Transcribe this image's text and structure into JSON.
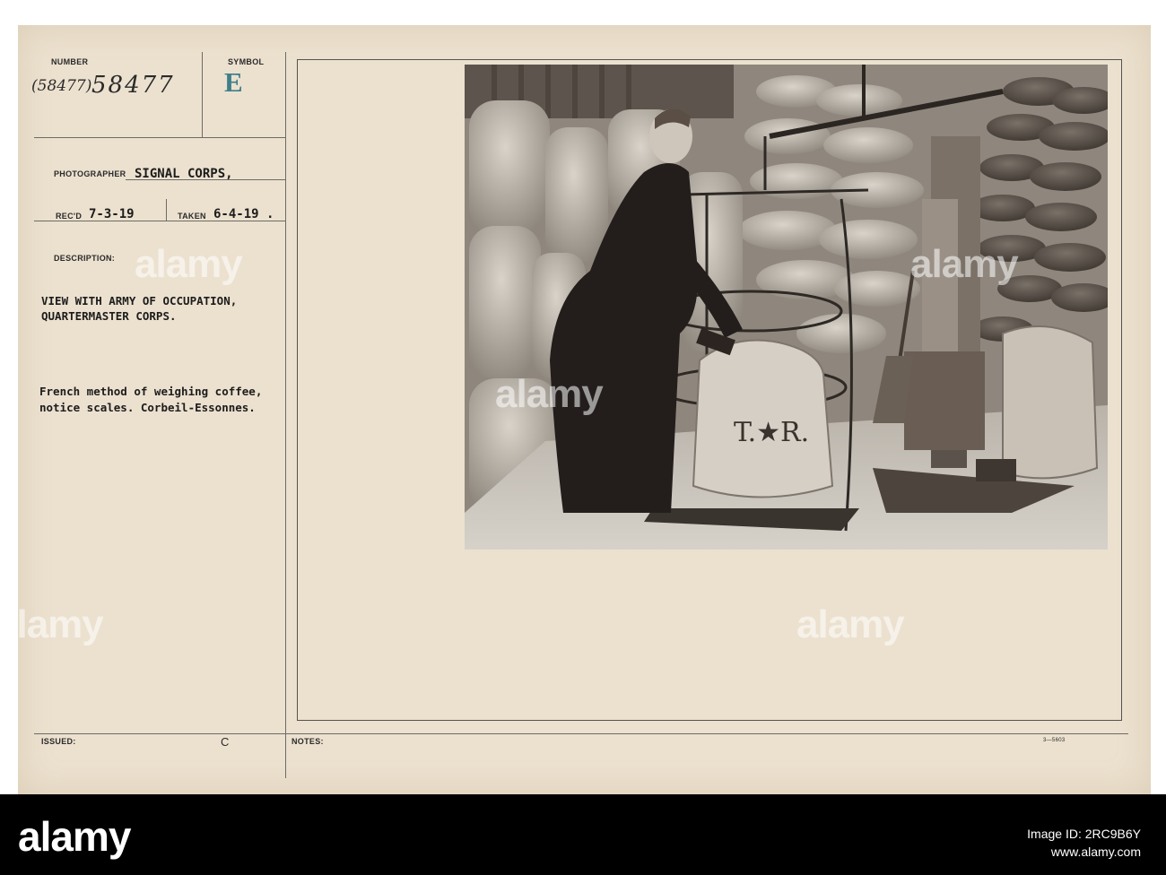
{
  "card": {
    "number_label": "NUMBER",
    "number_old": "(58477)",
    "number_value": "58477",
    "symbol_label": "SYMBOL",
    "symbol_value": "E",
    "photographer_label": "PHOTOGRAPHER",
    "photographer_value": "SIGNAL CORPS,",
    "recd_label": "REC'D",
    "recd_value": "7-3-19",
    "taken_label": "TAKEN",
    "taken_value": "6-4-19 .",
    "description_label": "DESCRIPTION:",
    "description_line1": "VIEW WITH ARMY OF OCCUPATION,",
    "description_line2": "QUARTERMASTER CORPS.",
    "caption_line1": "French method of weighing coffee,",
    "caption_line2": "notice scales. Corbeil-Essonnes.",
    "issued_label": "ISSUED:",
    "issued_value": "C",
    "notes_label": "NOTES:",
    "form_code": "3—5603"
  },
  "photo": {
    "alt": "Woman weighing a sack of coffee on a scale in a warehouse stacked with sacks",
    "sack_mark": "T.★R."
  },
  "watermark": {
    "text": "alamy"
  },
  "footer": {
    "logo": "alamy",
    "image_id_line": "Image ID: 2RC9B6Y",
    "site": "www.alamy.com"
  },
  "colors": {
    "card": "#ece1cf",
    "ink": "#1c1c1c",
    "footer": "#000000"
  }
}
